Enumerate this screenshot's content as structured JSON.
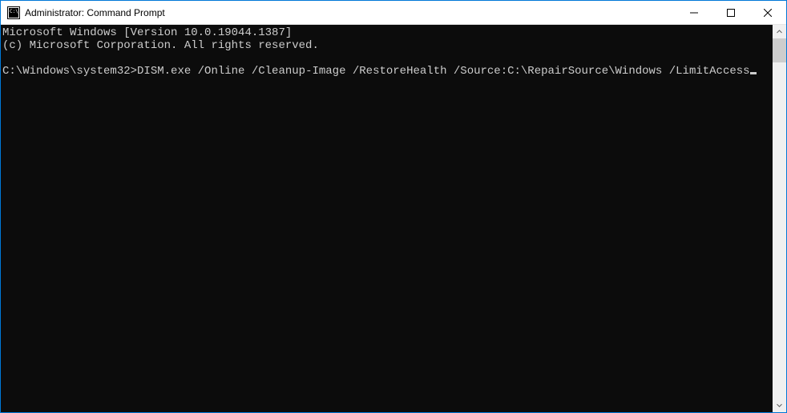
{
  "window": {
    "title": "Administrator: Command Prompt"
  },
  "console": {
    "line1": "Microsoft Windows [Version 10.0.19044.1387]",
    "line2": "(c) Microsoft Corporation. All rights reserved.",
    "blank": "",
    "prompt": "C:\\Windows\\system32>",
    "command": "DISM.exe /Online /Cleanup-Image /RestoreHealth /Source:C:\\RepairSource\\Windows /LimitAccess"
  }
}
